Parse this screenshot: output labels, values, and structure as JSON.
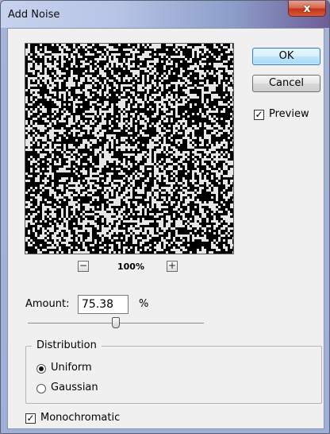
{
  "window": {
    "title": "Add Noise",
    "close_symbol": "x"
  },
  "buttons": {
    "ok": "OK",
    "cancel": "Cancel"
  },
  "preview_option": {
    "label": "Preview",
    "checked": true,
    "check_symbol": "✓"
  },
  "zoom": {
    "minus": "−",
    "level": "100%",
    "plus": "+"
  },
  "amount": {
    "label": "Amount:",
    "value": "75.38",
    "unit": "%",
    "slider_fraction": 0.5
  },
  "distribution": {
    "legend": "Distribution",
    "options": [
      {
        "label": "Uniform",
        "selected": true
      },
      {
        "label": "Gaussian",
        "selected": false
      }
    ]
  },
  "monochromatic": {
    "label": "Monochromatic",
    "checked": true,
    "check_symbol": "✓"
  },
  "colors": {
    "ok_border": "#3c7fb1",
    "close_red": "#c2341b"
  }
}
